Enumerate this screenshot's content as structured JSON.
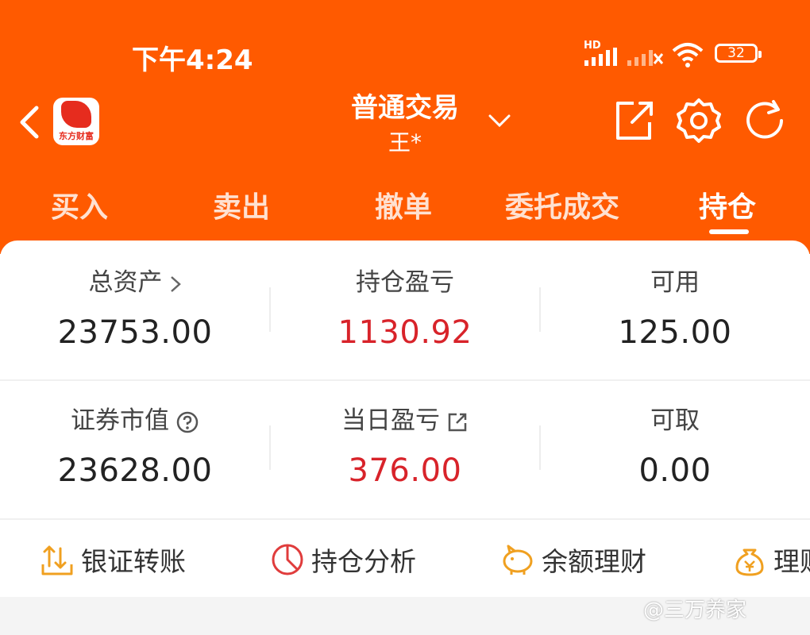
{
  "status_bar": {
    "time": "下午4:24",
    "network_label": "HD",
    "battery": "32"
  },
  "header": {
    "logo_text": "东方财富",
    "title": "普通交易",
    "account": "王*"
  },
  "tabs": [
    {
      "label": "买入"
    },
    {
      "label": "卖出"
    },
    {
      "label": "撤单"
    },
    {
      "label": "委托成交"
    },
    {
      "label": "持仓"
    }
  ],
  "summary": {
    "total_assets": {
      "label": "总资产",
      "value": "23753.00"
    },
    "position_pnl": {
      "label": "持仓盈亏",
      "value": "1130.92"
    },
    "available": {
      "label": "可用",
      "value": "125.00"
    },
    "market_value": {
      "label": "证券市值",
      "value": "23628.00"
    },
    "daily_pnl": {
      "label": "当日盈亏",
      "value": "376.00"
    },
    "withdrawable": {
      "label": "可取",
      "value": "0.00"
    }
  },
  "quick_actions": [
    {
      "label": "银证转账",
      "icon": "transfer-icon"
    },
    {
      "label": "持仓分析",
      "icon": "pie-chart-icon"
    },
    {
      "label": "余额理财",
      "icon": "piggy-bank-icon"
    },
    {
      "label": "理财",
      "icon": "money-bag-icon"
    }
  ],
  "watermark": "@三万养家",
  "colors": {
    "header_bg": "#ff5a00",
    "profit_red": "#d8232a",
    "icon_orange": "#f0a020"
  }
}
